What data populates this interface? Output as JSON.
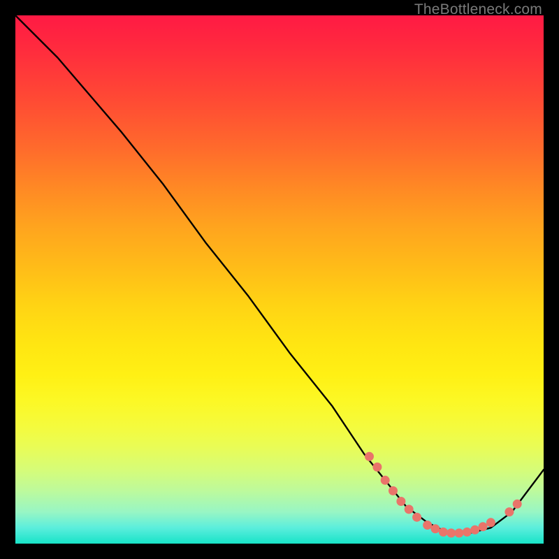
{
  "watermark": "TheBottleneck.com",
  "chart_data": {
    "type": "line",
    "title": "",
    "xlabel": "",
    "ylabel": "",
    "xlim": [
      0,
      100
    ],
    "ylim": [
      0,
      100
    ],
    "series": [
      {
        "name": "bottleneck-curve",
        "x": [
          0,
          8,
          14,
          20,
          28,
          36,
          44,
          52,
          60,
          66,
          70,
          74,
          78,
          82,
          86,
          90,
          94,
          100
        ],
        "values": [
          100,
          92,
          85,
          78,
          68,
          57,
          47,
          36,
          26,
          17,
          12,
          7,
          4,
          2,
          2,
          3,
          6,
          14
        ]
      }
    ],
    "highlight_points": {
      "name": "marker-dots",
      "color": "#e9746a",
      "points": [
        {
          "x": 67,
          "y": 16.5
        },
        {
          "x": 68.5,
          "y": 14.5
        },
        {
          "x": 70,
          "y": 12
        },
        {
          "x": 71.5,
          "y": 10
        },
        {
          "x": 73,
          "y": 8
        },
        {
          "x": 74.5,
          "y": 6.5
        },
        {
          "x": 76,
          "y": 5
        },
        {
          "x": 78,
          "y": 3.5
        },
        {
          "x": 79.5,
          "y": 2.8
        },
        {
          "x": 81,
          "y": 2.2
        },
        {
          "x": 82.5,
          "y": 2
        },
        {
          "x": 84,
          "y": 2
        },
        {
          "x": 85.5,
          "y": 2.2
        },
        {
          "x": 87,
          "y": 2.6
        },
        {
          "x": 88.5,
          "y": 3.2
        },
        {
          "x": 90,
          "y": 4
        },
        {
          "x": 93.5,
          "y": 6
        },
        {
          "x": 95,
          "y": 7.5
        }
      ]
    }
  }
}
